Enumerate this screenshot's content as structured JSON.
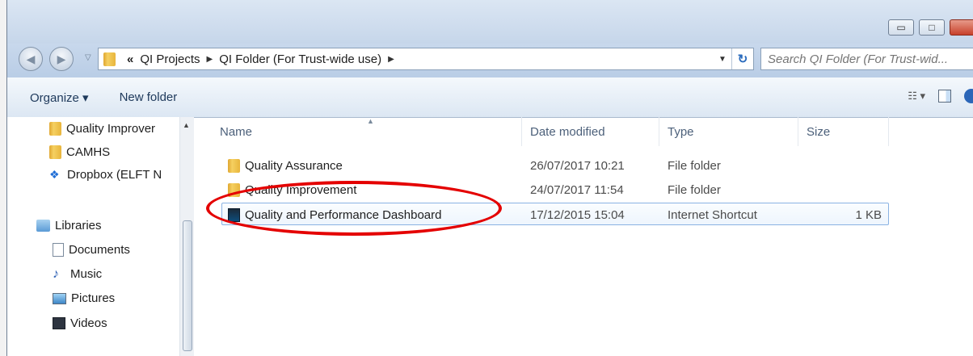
{
  "window_controls": {
    "minimize": "▭",
    "maximize": "□"
  },
  "address": {
    "overflow": "«",
    "crumbs": [
      "QI Projects",
      "QI Folder (For Trust-wide use)"
    ]
  },
  "search": {
    "placeholder": "Search QI Folder (For Trust-wid..."
  },
  "toolbar": {
    "organize": "Organize ▾",
    "new_folder": "New folder"
  },
  "sidebar": {
    "items": [
      {
        "label": "Quality Improver"
      },
      {
        "label": "CAMHS"
      },
      {
        "label": "Dropbox (ELFT N"
      },
      {
        "label": "Libraries"
      },
      {
        "label": "Documents"
      },
      {
        "label": "Music"
      },
      {
        "label": "Pictures"
      },
      {
        "label": "Videos"
      }
    ]
  },
  "columns": {
    "name": "Name",
    "date": "Date modified",
    "type": "Type",
    "size": "Size"
  },
  "files": [
    {
      "name": "Quality Assurance",
      "date": "26/07/2017 10:21",
      "type": "File folder",
      "size": ""
    },
    {
      "name": "Quality Improvement",
      "date": "24/07/2017 11:54",
      "type": "File folder",
      "size": ""
    },
    {
      "name": "Quality and Performance Dashboard",
      "date": "17/12/2015 15:04",
      "type": "Internet Shortcut",
      "size": "1 KB"
    }
  ],
  "colors": {
    "annotation_circle": "#e40000",
    "selection_border": "#8ab2e3"
  }
}
